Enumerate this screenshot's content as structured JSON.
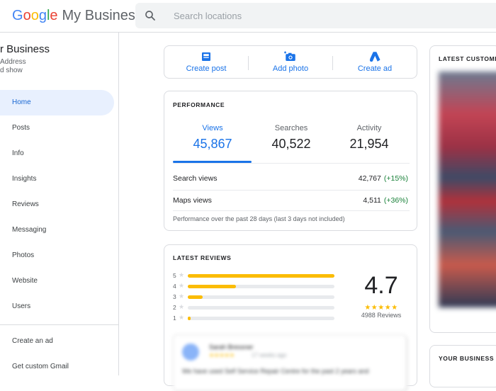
{
  "header": {
    "logo_google": [
      "G",
      "o",
      "o",
      "g",
      "l",
      "e"
    ],
    "logo_product": "My Business",
    "search_placeholder": "Search locations"
  },
  "sidebar": {
    "business_name": "r Business",
    "address_fragment": "Address",
    "show_fragment": "d show",
    "items": [
      {
        "label": "Home",
        "active": true
      },
      {
        "label": "Posts"
      },
      {
        "label": "Info"
      },
      {
        "label": "Insights"
      },
      {
        "label": "Reviews"
      },
      {
        "label": "Messaging"
      },
      {
        "label": "Photos"
      },
      {
        "label": "Website"
      },
      {
        "label": "Users"
      }
    ],
    "bottom_items": [
      {
        "label": "Create an ad"
      },
      {
        "label": "Get custom Gmail"
      }
    ]
  },
  "actions": {
    "create_post": "Create post",
    "add_photo": "Add photo",
    "create_ad": "Create ad"
  },
  "performance": {
    "title": "PERFORMANCE",
    "metrics": [
      {
        "label": "Views",
        "value": "45,867"
      },
      {
        "label": "Searches",
        "value": "40,522"
      },
      {
        "label": "Activity",
        "value": "21,954"
      }
    ],
    "rows": [
      {
        "label": "Search views",
        "value": "42,767",
        "change": "(+15%)"
      },
      {
        "label": "Maps views",
        "value": "4,511",
        "change": "(+36%)"
      }
    ],
    "note": "Performance over the past 28 days (last 3 days not included)"
  },
  "reviews": {
    "title": "LATEST REVIEWS",
    "distribution": [
      {
        "stars": "5",
        "fraction": 1.0
      },
      {
        "stars": "4",
        "fraction": 0.33
      },
      {
        "stars": "3",
        "fraction": 0.1
      },
      {
        "stars": "2",
        "fraction": 0.0
      },
      {
        "stars": "1",
        "fraction": 0.02
      }
    ],
    "average": "4.7",
    "stars_display": "★★★★★",
    "count": "4988 Reviews",
    "preview": {
      "name": "Sarah Bressner",
      "stars": "★★★★★",
      "time": "17 weeks ago",
      "text": "We have used Self Service Repair Centre for the past 2 years and"
    }
  },
  "photos": {
    "title": "LATEST CUSTOME"
  },
  "bizinfo": {
    "title": "YOUR BUSINESS I"
  },
  "colors": {
    "accent": "#1a73e8",
    "positive": "#188038",
    "star": "#fbbc04",
    "active_bg": "#e8f0fe"
  }
}
